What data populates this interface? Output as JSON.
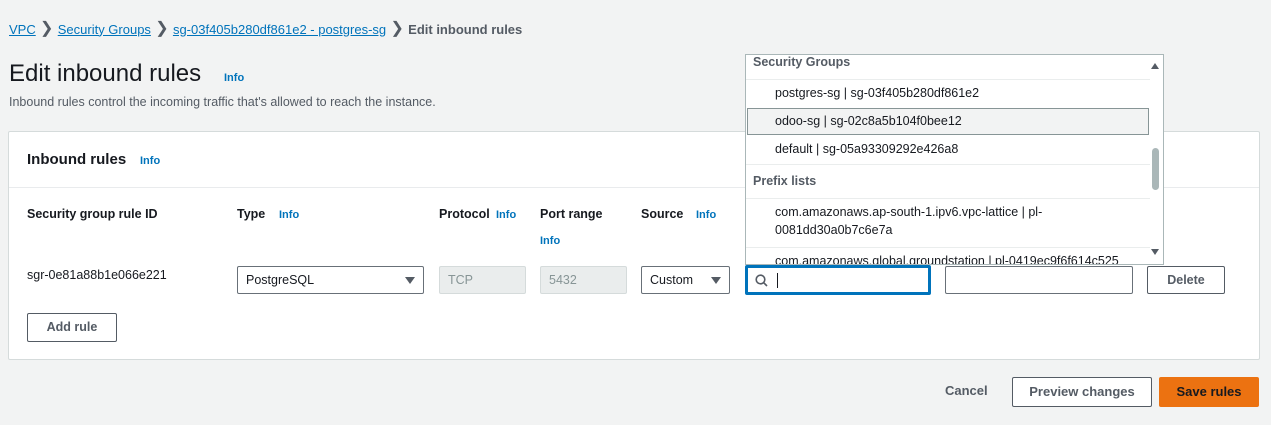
{
  "breadcrumb": {
    "items": [
      "VPC",
      "Security Groups",
      "sg-03f405b280df861e2 - postgres-sg"
    ],
    "separator": "❯",
    "current": "Edit inbound rules"
  },
  "page": {
    "title": "Edit inbound rules",
    "info": "Info",
    "description": "Inbound rules control the incoming traffic that's allowed to reach the instance."
  },
  "panel": {
    "title": "Inbound rules",
    "info": "Info",
    "columns": {
      "rule_id": "Security group rule ID",
      "type": "Type",
      "type_info": "Info",
      "protocol": "Protocol",
      "protocol_info": "Info",
      "port_range": "Port range",
      "port_info": "Info",
      "source": "Source",
      "source_info": "Info"
    },
    "row": {
      "rule_id": "sgr-0e81a88b1e066e221",
      "type": "PostgreSQL",
      "protocol": "TCP",
      "port": "5432",
      "source": "Custom",
      "source_search": "",
      "description": "",
      "delete_label": "Delete"
    },
    "add_rule_label": "Add rule"
  },
  "dropdown": {
    "group_security": "Security Groups",
    "security_options": [
      "postgres-sg | sg-03f405b280df861e2",
      "odoo-sg | sg-02c8a5b104f0bee12",
      "default | sg-05a93309292e426a8"
    ],
    "group_prefix": "Prefix lists",
    "prefix_options": [
      "com.amazonaws.ap-south-1.ipv6.vpc-lattice | pl-",
      "0081dd30a0b7c6e7a",
      "com.amazonaws.global.groundstation | pl-0419ec9f6f614c525"
    ]
  },
  "footer": {
    "cancel": "Cancel",
    "preview": "Preview changes",
    "save": "Save rules"
  },
  "colors": {
    "link": "#0073bb",
    "primary": "#ec7211",
    "focus": "#0073bb"
  }
}
